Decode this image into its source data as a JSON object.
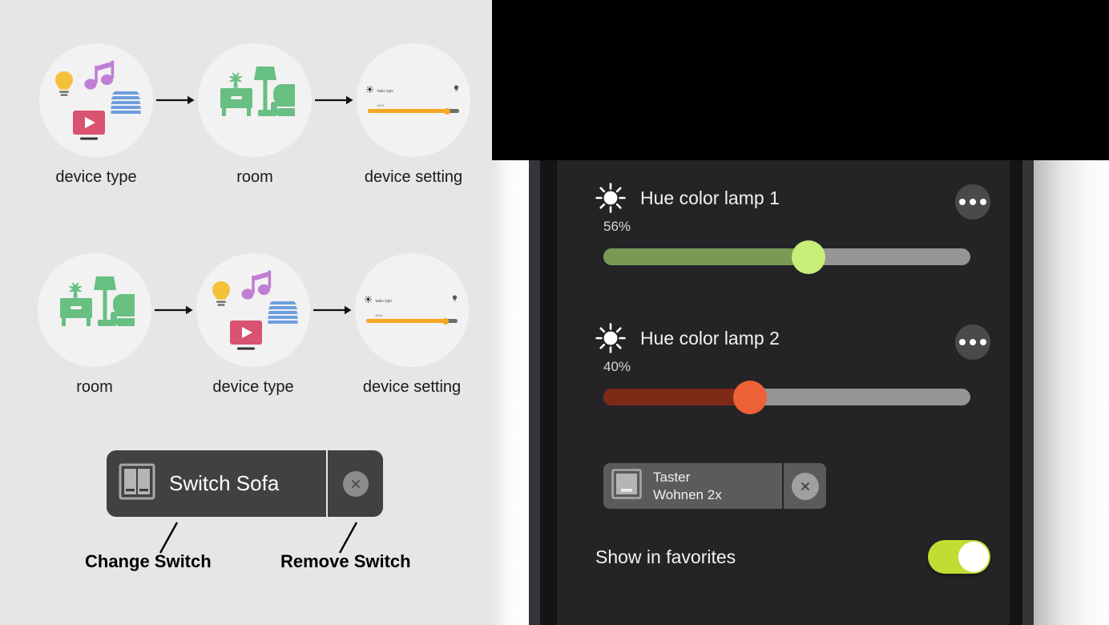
{
  "colors": {
    "page_bg": "#e6e6e6",
    "bubble_bg": "#f2f2f2",
    "chip_bg": "#414141",
    "app_bg": "#242427",
    "slider1_fill": "#7a9a54",
    "slider1_thumb": "#c8ee7a",
    "slider2_fill": "#7d2a16",
    "slider2_thumb": "#ec6136",
    "slider_track": "#959595",
    "toggle_on": "#c3dc33",
    "icon_bulb": "#f5c13b",
    "icon_music": "#c07fd4",
    "icon_media": "#d9526f",
    "icon_blinds": "#6e9ede",
    "icon_room": "#68bf82",
    "mini_slider": "#f5a623"
  },
  "diagram": {
    "flows": [
      {
        "steps": [
          {
            "label": "device type",
            "icon": "device-type-cluster-icon"
          },
          {
            "label": "room",
            "icon": "room-furniture-icon"
          },
          {
            "label": "device setting",
            "icon": "device-setting-slider-icon"
          }
        ]
      },
      {
        "steps": [
          {
            "label": "room",
            "icon": "room-furniture-icon"
          },
          {
            "label": "device type",
            "icon": "device-type-cluster-icon"
          },
          {
            "label": "device setting",
            "icon": "device-setting-slider-icon"
          }
        ]
      }
    ],
    "mini_setting": {
      "title": "Table light",
      "percent": "100%",
      "sun_icon": "brightness-icon",
      "right_icon": "lightbulb-icon"
    },
    "switch_chip": {
      "icon": "double-rocker-switch-icon",
      "label": "Switch Sofa",
      "remove_icon": "close-circle-icon"
    },
    "callouts": [
      {
        "text": "Change Switch"
      },
      {
        "text": "Remove Switch"
      }
    ]
  },
  "app": {
    "devices": [
      {
        "icon": "brightness-sun-icon",
        "name": "Hue color lamp 1",
        "percent": "56%",
        "slider_value": 56,
        "menu_icon": "more-options-icon"
      },
      {
        "icon": "brightness-sun-icon",
        "name": "Hue color lamp 2",
        "percent": "40%",
        "slider_value": 40,
        "menu_icon": "more-options-icon"
      }
    ],
    "switch_chip": {
      "icon": "single-rocker-switch-icon",
      "line1": "Taster",
      "line2": "Wohnen 2x",
      "remove_icon": "close-circle-icon"
    },
    "favorites": {
      "label": "Show in favorites",
      "toggle_state": "on"
    }
  }
}
